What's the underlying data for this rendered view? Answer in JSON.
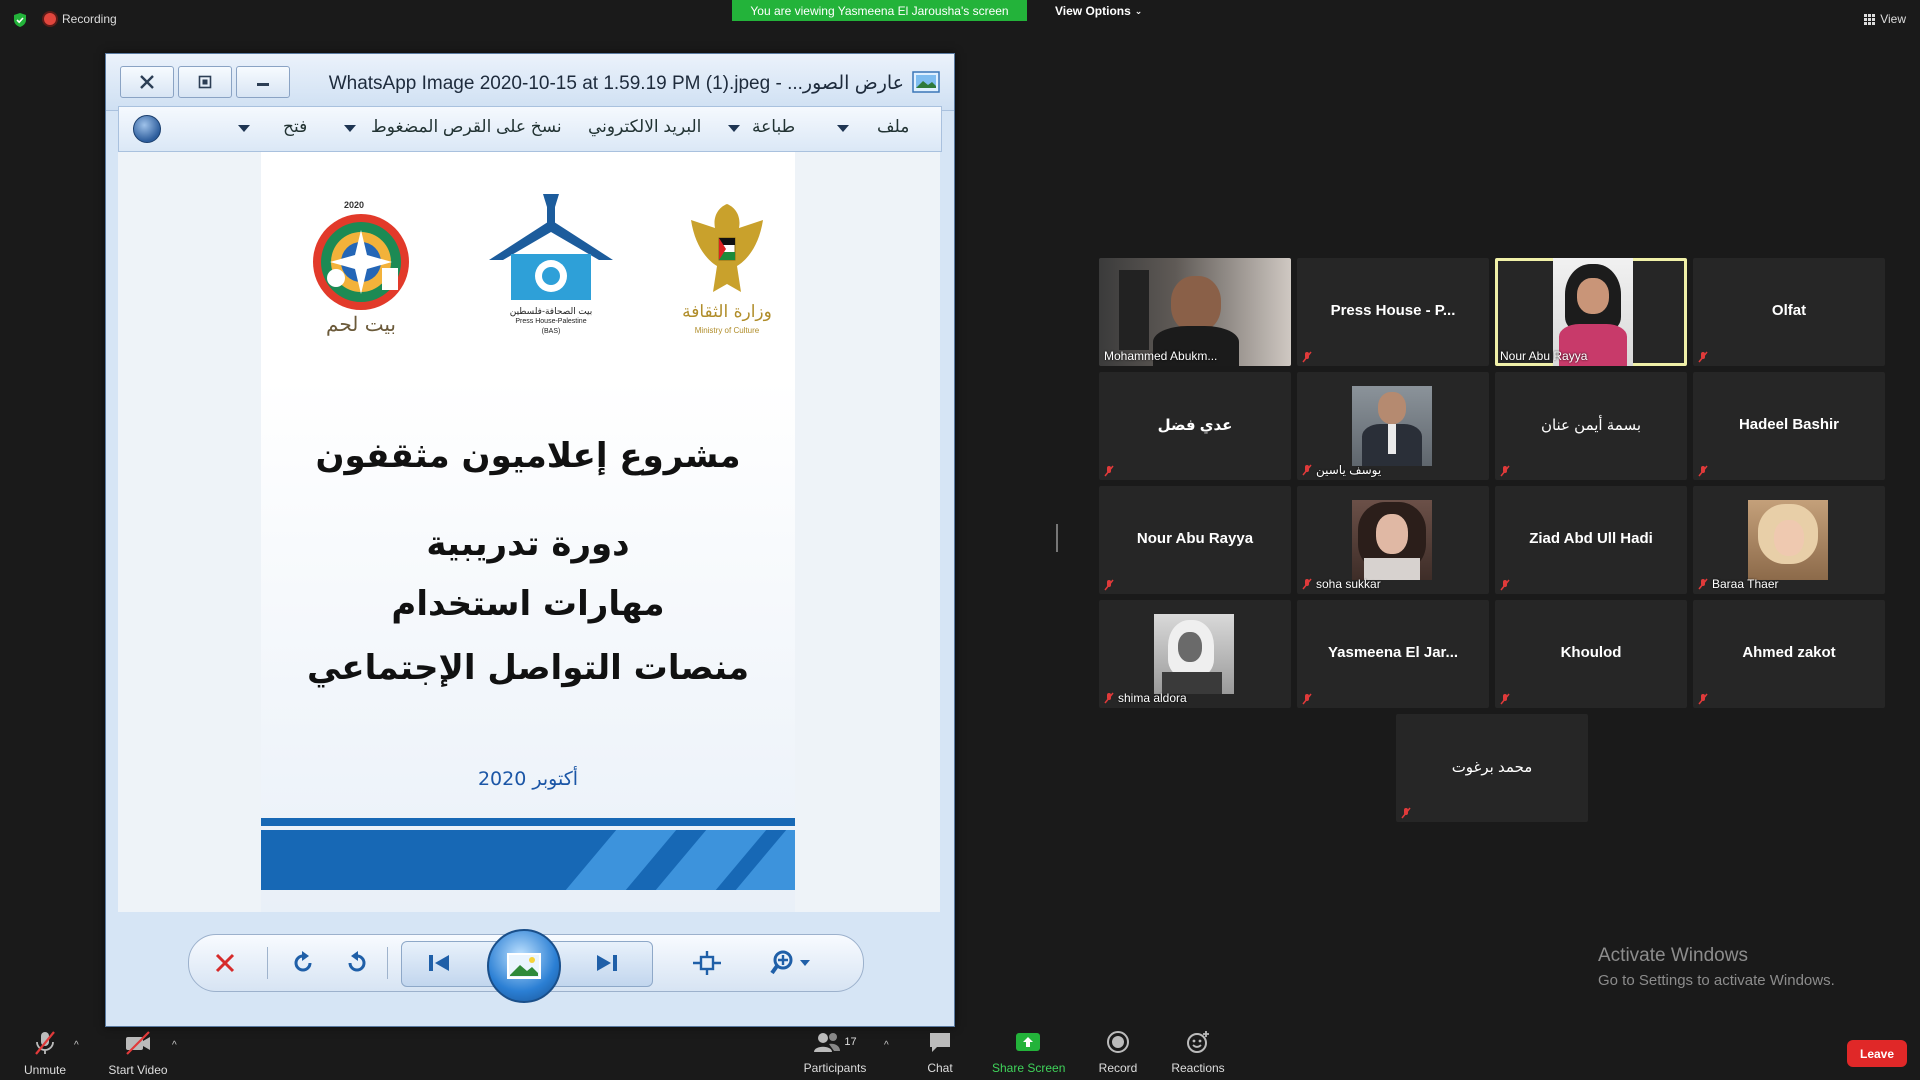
{
  "top_bar": {
    "recording_label": "Recording",
    "viewing_banner": "You are viewing Yasmeena El Jarousha's screen",
    "view_options": "View Options",
    "view_label": "View"
  },
  "viewer": {
    "title": "عارض الصور... - WhatsApp Image 2020-10-15 at 1.59.19 PM (1).jpeg",
    "menu": {
      "file": "ملف",
      "print": "طباعة",
      "email": "البريد الالكتروني",
      "burn": "نسخ على القرص المضغوط",
      "open": "فتح"
    },
    "document": {
      "line1": "مشروع إعلاميون مثقفون",
      "line2": "دورة تدريبية",
      "line3": "مهارات استخدام",
      "line4": "منصات التواصل الإجتماعي",
      "date": "أكتوبر 2020",
      "logo_left_year": "2020",
      "logo_left_text": "بيت لحم",
      "logo_center_ar": "بيت الصحافة-فلسطين",
      "logo_center_en": "Press House-Palestine",
      "logo_center_abbr": "(BAS)",
      "logo_right_ar": "وزارة الثقافة",
      "logo_right_en": "Ministry of Culture"
    }
  },
  "participants": [
    {
      "name": "Mohammed Abukm...",
      "has_video": true
    },
    {
      "name": "Press House - P...",
      "has_video": false
    },
    {
      "name": "Nour Abu Rayya",
      "has_video": true,
      "active_speaker": true
    },
    {
      "name": "Olfat",
      "has_video": false
    },
    {
      "name": "عدي فضل",
      "has_video": false
    },
    {
      "name": "يوسف ياسين",
      "has_video": true
    },
    {
      "name": "بسمة أيمن عنان",
      "has_video": false
    },
    {
      "name": "Hadeel Bashir",
      "has_video": false
    },
    {
      "name": "Nour Abu Rayya",
      "has_video": false
    },
    {
      "name": "soha sukkar",
      "has_video": true
    },
    {
      "name": "Ziad Abd Ull Hadi",
      "has_video": false
    },
    {
      "name": "Baraa Thaer",
      "has_video": true
    },
    {
      "name": "shima aldora",
      "has_video": true
    },
    {
      "name": "Yasmeena El Jar...",
      "has_video": false
    },
    {
      "name": "Khoulod",
      "has_video": false
    },
    {
      "name": "Ahmed zakot",
      "has_video": false
    },
    {
      "name": "محمد برغوت",
      "has_video": false
    }
  ],
  "activation": {
    "title": "Activate Windows",
    "subtitle": "Go to Settings to activate Windows."
  },
  "toolbar": {
    "unmute": "Unmute",
    "start_video": "Start Video",
    "participants": "Participants",
    "participant_count": "17",
    "chat": "Chat",
    "share_screen": "Share Screen",
    "record": "Record",
    "reactions": "Reactions",
    "leave": "Leave"
  },
  "colors": {
    "share_green": "#23b33a",
    "leave_red": "#e02828",
    "active_outline": "#f0f0a8",
    "tile_bg": "#262626"
  }
}
